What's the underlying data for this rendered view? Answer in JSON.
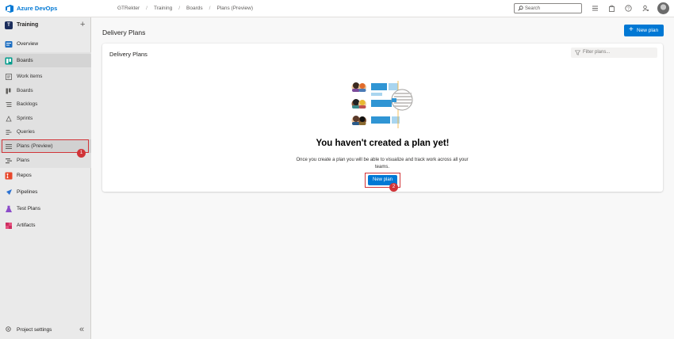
{
  "app": {
    "brand": "Azure DevOps"
  },
  "breadcrumb": [
    "GTRekter",
    "Training",
    "Boards",
    "Plans (Preview)"
  ],
  "search": {
    "placeholder": "Search"
  },
  "sidebar": {
    "project_initial": "T",
    "project_name": "Training",
    "items": [
      {
        "label": "Overview",
        "icon": "overview-icon"
      },
      {
        "label": "Boards",
        "icon": "boards-icon"
      },
      {
        "label": "Work items",
        "icon": "work-items-icon"
      },
      {
        "label": "Boards",
        "icon": "board-icon"
      },
      {
        "label": "Backlogs",
        "icon": "backlogs-icon"
      },
      {
        "label": "Sprints",
        "icon": "sprints-icon"
      },
      {
        "label": "Queries",
        "icon": "queries-icon"
      },
      {
        "label": "Plans (Preview)",
        "icon": "plans-preview-icon"
      },
      {
        "label": "Plans",
        "icon": "plans-icon"
      },
      {
        "label": "Repos",
        "icon": "repos-icon"
      },
      {
        "label": "Pipelines",
        "icon": "pipelines-icon"
      },
      {
        "label": "Test Plans",
        "icon": "test-plans-icon"
      },
      {
        "label": "Artifacts",
        "icon": "artifacts-icon"
      }
    ],
    "settings_label": "Project settings"
  },
  "main": {
    "title": "Delivery Plans",
    "new_plan_label": "New plan",
    "card_title": "Delivery Plans",
    "filter_placeholder": "Filter plans...",
    "empty_title": "You haven't created a plan yet!",
    "empty_desc": "Once you create a plan you will be able to visualize and track work across all your teams.",
    "center_button": "New plan"
  },
  "annotations": {
    "badge1": "1",
    "badge2": "2"
  },
  "colors": {
    "accent": "#0078d4",
    "highlight": "#d13438"
  }
}
